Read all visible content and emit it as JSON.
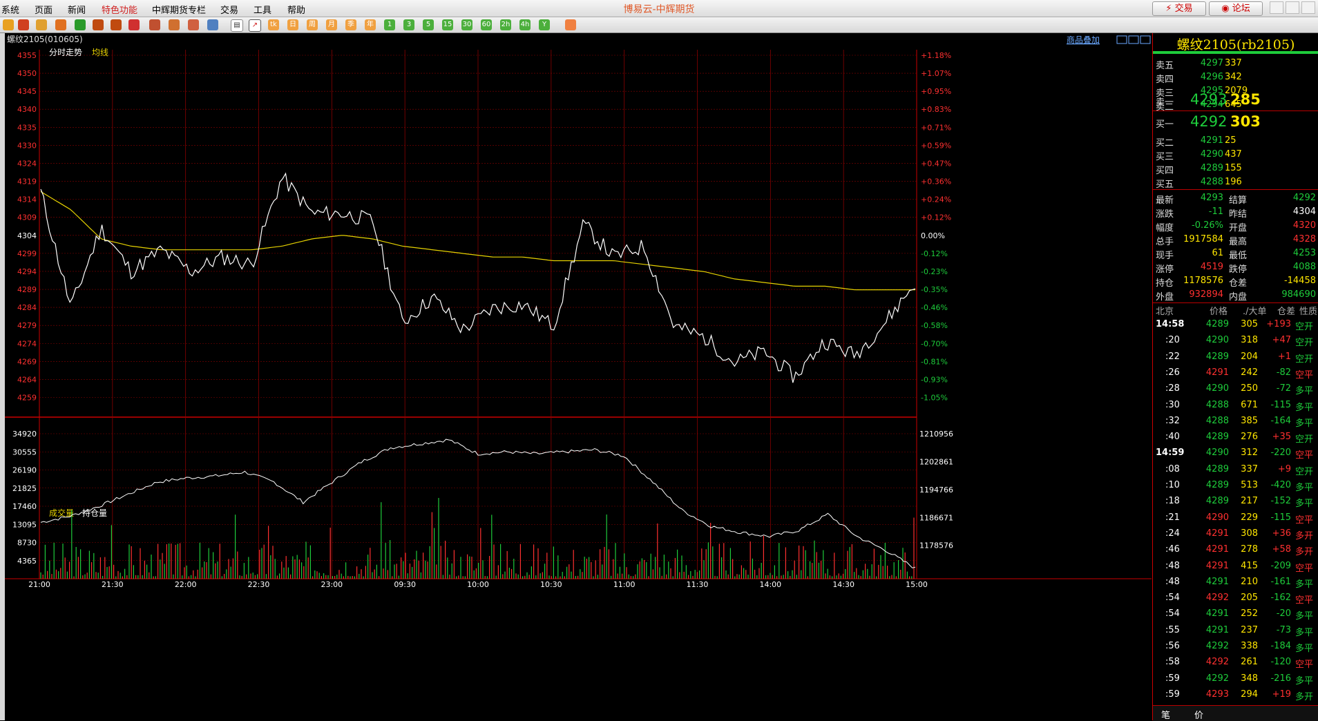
{
  "menu": {
    "items": [
      "系统",
      "页面",
      "新闻",
      "特色功能",
      "中辉期货专栏",
      "交易",
      "工具",
      "帮助"
    ],
    "title": "博易云-中辉期货",
    "trade_btn": "⚡ 交易",
    "forum_btn": "◉ 论坛"
  },
  "toolbar": {
    "periods": [
      "日",
      "周",
      "月",
      "季",
      "年",
      "1",
      "3",
      "5",
      "15",
      "30",
      "60",
      "2h",
      "4h",
      "Y"
    ]
  },
  "chart": {
    "instrument_label": "螺纹2105(010605)",
    "overlay_link": "商品叠加",
    "main_label": "分时走势",
    "avg_label": "均线",
    "vol_label": "成交量",
    "oi_label": "持仓量",
    "colors": {
      "grid": "#8a0000",
      "price": "#ffffff",
      "avg": "#e6d200",
      "up": "#ff3030",
      "down": "#1ecc3b",
      "axis_text": "#ff3030",
      "neutral": "#ffffff"
    },
    "price_ticks": [
      "4355",
      "4350",
      "4345",
      "4340",
      "4335",
      "4330",
      "4324",
      "4319",
      "4314",
      "4309",
      "4304",
      "4299",
      "4294",
      "4289",
      "4284",
      "4279",
      "4274",
      "4269",
      "4264",
      "4259"
    ],
    "pct_ticks": [
      "+1.18%",
      "+1.07%",
      "+0.95%",
      "+0.83%",
      "+0.71%",
      "+0.59%",
      "+0.47%",
      "+0.36%",
      "+0.24%",
      "+0.12%",
      "0.00%",
      "-0.12%",
      "-0.23%",
      "-0.35%",
      "-0.46%",
      "-0.58%",
      "-0.70%",
      "-0.81%",
      "-0.93%",
      "-1.05%"
    ],
    "vol_ticks": [
      "34920",
      "30555",
      "26190",
      "21825",
      "17460",
      "13095",
      "8730",
      "4365"
    ],
    "oi_ticks": [
      "1210956",
      "1202861",
      "1194766",
      "1186671",
      "1178576"
    ],
    "time_ticks": [
      "21:00",
      "21:30",
      "22:00",
      "22:30",
      "23:00",
      "09:30",
      "10:00",
      "10:30",
      "11:00",
      "11:30",
      "14:00",
      "14:30",
      "15:00"
    ]
  },
  "chart_data": {
    "type": "line",
    "title": "螺纹2105(010605)",
    "ylim": [
      4256,
      4357
    ],
    "reference_price": 4304,
    "x": [
      "21:00",
      "21:30",
      "22:00",
      "22:30",
      "23:00",
      "09:30",
      "10:00",
      "10:30",
      "11:00",
      "11:30",
      "14:00",
      "14:30",
      "15:00"
    ],
    "series": [
      {
        "name": "分时走势",
        "values": [
          4318,
          4286,
          4308,
          4296,
          4302,
          4296,
          4300,
          4298,
          4322,
          4312,
          4312,
          4310,
          4282,
          4289,
          4280,
          4286,
          4287,
          4281,
          4309,
          4300,
          4303,
          4281,
          4278,
          4271,
          4274,
          4267,
          4277,
          4273,
          4282,
          4293
        ]
      },
      {
        "name": "均线",
        "values": [
          4318,
          4313,
          4305,
          4303,
          4302,
          4302,
          4302,
          4302,
          4303,
          4305,
          4306,
          4305,
          4303,
          4302,
          4301,
          4300,
          4300,
          4299,
          4299,
          4299,
          4298,
          4297,
          4296,
          4294,
          4293,
          4292,
          4292,
          4291,
          4291,
          4291
        ]
      }
    ],
    "volume": {
      "name": "成交量",
      "ylim": [
        0,
        36000
      ]
    },
    "open_interest": {
      "name": "持仓量",
      "ylim": [
        1176000,
        1212000
      ],
      "values": [
        1190000,
        1191500,
        1194000,
        1197000,
        1200000,
        1201000,
        1201500,
        1202500,
        1200000,
        1195000,
        1200000,
        1205000,
        1208500,
        1209500,
        1210500,
        1207000,
        1207500,
        1207000,
        1207500,
        1208000,
        1206500,
        1200000,
        1193000,
        1189000,
        1187500,
        1186500,
        1188000,
        1192000,
        1186500,
        1183000,
        1178576
      ]
    }
  },
  "quote": {
    "title": "螺纹2105(rb2105)",
    "asks": [
      {
        "label": "卖五",
        "price": "4297",
        "vol": "337"
      },
      {
        "label": "卖四",
        "price": "4296",
        "vol": "342"
      },
      {
        "label": "卖三",
        "price": "4295",
        "vol": "2079"
      },
      {
        "label": "卖二",
        "price": "4294",
        "vol": "645"
      },
      {
        "label": "卖一",
        "price": "4293",
        "vol": "285"
      }
    ],
    "bids": [
      {
        "label": "买一",
        "price": "4292",
        "vol": "303"
      },
      {
        "label": "买二",
        "price": "4291",
        "vol": "25"
      },
      {
        "label": "买三",
        "price": "4290",
        "vol": "437"
      },
      {
        "label": "买四",
        "price": "4289",
        "vol": "155"
      },
      {
        "label": "买五",
        "price": "4288",
        "vol": "196"
      }
    ],
    "stats": [
      {
        "l1": "最新",
        "v1": "4293",
        "c1": "green",
        "l2": "结算",
        "v2": "4292",
        "c2": "green"
      },
      {
        "l1": "涨跌",
        "v1": "-11",
        "c1": "green",
        "l2": "昨结",
        "v2": "4304",
        "c2": "white"
      },
      {
        "l1": "幅度",
        "v1": "-0.26%",
        "c1": "green",
        "l2": "开盘",
        "v2": "4320",
        "c2": "red"
      },
      {
        "l1": "总手",
        "v1": "1917584",
        "c1": "yellow",
        "l2": "最高",
        "v2": "4328",
        "c2": "red"
      },
      {
        "l1": "现手",
        "v1": "61",
        "c1": "yellow",
        "l2": "最低",
        "v2": "4253",
        "c2": "green"
      },
      {
        "l1": "涨停",
        "v1": "4519",
        "c1": "red",
        "l2": "跌停",
        "v2": "4088",
        "c2": "green"
      },
      {
        "l1": "持仓",
        "v1": "1178576",
        "c1": "yellow",
        "l2": "仓差",
        "v2": "-14458",
        "c2": "yellow"
      },
      {
        "l1": "外盘",
        "v1": "932894",
        "c1": "red",
        "l2": "内盘",
        "v2": "984690",
        "c2": "green"
      }
    ],
    "ticks_header": {
      "time": "北京",
      "price": "价格",
      "vol": "./大单",
      "oi": "仓差",
      "nature": "性质"
    },
    "ticks": [
      {
        "t": "14:58",
        "p": "4289",
        "pc": "green",
        "v": "305",
        "d": "+193",
        "dc": "red",
        "n": "空开",
        "nc": "green"
      },
      {
        "t": ":20",
        "p": "4290",
        "pc": "green",
        "v": "318",
        "d": "+47",
        "dc": "red",
        "n": "空开",
        "nc": "green"
      },
      {
        "t": ":22",
        "p": "4289",
        "pc": "green",
        "v": "204",
        "d": "+1",
        "dc": "red",
        "n": "空开",
        "nc": "green"
      },
      {
        "t": ":26",
        "p": "4291",
        "pc": "red",
        "v": "242",
        "d": "-82",
        "dc": "green",
        "n": "空平",
        "nc": "red"
      },
      {
        "t": ":28",
        "p": "4290",
        "pc": "green",
        "v": "250",
        "d": "-72",
        "dc": "green",
        "n": "多平",
        "nc": "green"
      },
      {
        "t": ":30",
        "p": "4288",
        "pc": "green",
        "v": "671",
        "d": "-115",
        "dc": "green",
        "n": "多平",
        "nc": "green"
      },
      {
        "t": ":32",
        "p": "4288",
        "pc": "green",
        "v": "385",
        "d": "-164",
        "dc": "green",
        "n": "多平",
        "nc": "green"
      },
      {
        "t": ":40",
        "p": "4289",
        "pc": "green",
        "v": "276",
        "d": "+35",
        "dc": "red",
        "n": "空开",
        "nc": "green"
      },
      {
        "t": "14:59",
        "p": "4290",
        "pc": "green",
        "v": "312",
        "d": "-220",
        "dc": "green",
        "n": "空平",
        "nc": "red"
      },
      {
        "t": ":08",
        "p": "4289",
        "pc": "green",
        "v": "337",
        "d": "+9",
        "dc": "red",
        "n": "空开",
        "nc": "green"
      },
      {
        "t": ":10",
        "p": "4289",
        "pc": "green",
        "v": "513",
        "d": "-420",
        "dc": "green",
        "n": "多平",
        "nc": "green"
      },
      {
        "t": ":18",
        "p": "4289",
        "pc": "green",
        "v": "217",
        "d": "-152",
        "dc": "green",
        "n": "多平",
        "nc": "green"
      },
      {
        "t": ":21",
        "p": "4290",
        "pc": "red",
        "v": "229",
        "d": "-115",
        "dc": "green",
        "n": "空平",
        "nc": "red"
      },
      {
        "t": ":24",
        "p": "4291",
        "pc": "red",
        "v": "308",
        "d": "+36",
        "dc": "red",
        "n": "多开",
        "nc": "red"
      },
      {
        "t": ":46",
        "p": "4291",
        "pc": "red",
        "v": "278",
        "d": "+58",
        "dc": "red",
        "n": "多开",
        "nc": "red"
      },
      {
        "t": ":48",
        "p": "4291",
        "pc": "red",
        "v": "415",
        "d": "-209",
        "dc": "green",
        "n": "空平",
        "nc": "red"
      },
      {
        "t": ":48",
        "p": "4291",
        "pc": "green",
        "v": "210",
        "d": "-161",
        "dc": "green",
        "n": "多平",
        "nc": "green"
      },
      {
        "t": ":54",
        "p": "4292",
        "pc": "red",
        "v": "205",
        "d": "-162",
        "dc": "green",
        "n": "空平",
        "nc": "red"
      },
      {
        "t": ":54",
        "p": "4291",
        "pc": "green",
        "v": "252",
        "d": "-20",
        "dc": "green",
        "n": "多平",
        "nc": "green"
      },
      {
        "t": ":55",
        "p": "4291",
        "pc": "green",
        "v": "237",
        "d": "-73",
        "dc": "green",
        "n": "多平",
        "nc": "green"
      },
      {
        "t": ":56",
        "p": "4292",
        "pc": "green",
        "v": "338",
        "d": "-184",
        "dc": "green",
        "n": "多平",
        "nc": "green"
      },
      {
        "t": ":58",
        "p": "4292",
        "pc": "red",
        "v": "261",
        "d": "-120",
        "dc": "green",
        "n": "空平",
        "nc": "red"
      },
      {
        "t": ":59",
        "p": "4292",
        "pc": "green",
        "v": "348",
        "d": "-216",
        "dc": "green",
        "n": "多平",
        "nc": "green"
      },
      {
        "t": ":59",
        "p": "4293",
        "pc": "red",
        "v": "294",
        "d": "+19",
        "dc": "red",
        "n": "多开",
        "nc": "green"
      }
    ],
    "bottom_tabs": [
      "笔",
      "价"
    ]
  }
}
